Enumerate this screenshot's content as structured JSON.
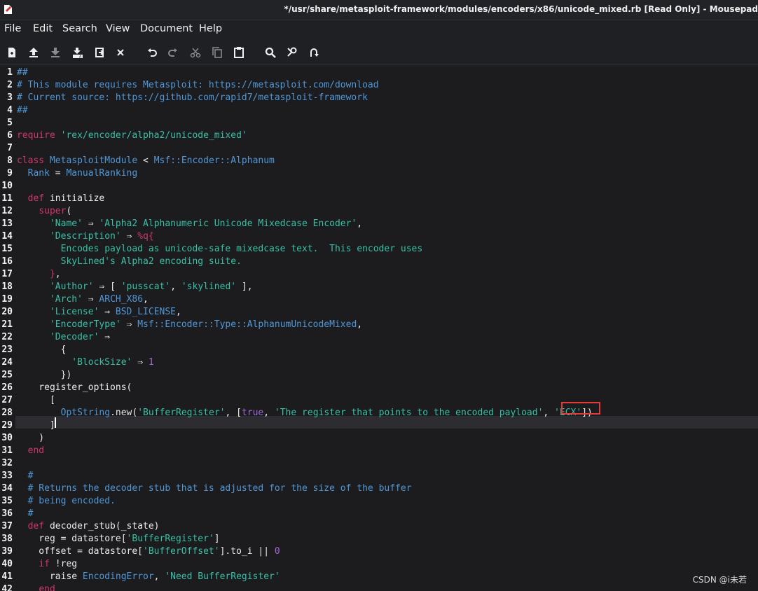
{
  "window": {
    "title": "*/usr/share/metasploit-framework/modules/encoders/x86/unicode_mixed.rb [Read Only] - Mousepad",
    "app_icon": "mousepad-icon"
  },
  "menu": [
    "File",
    "Edit",
    "Search",
    "View",
    "Document",
    "Help"
  ],
  "toolbar": [
    {
      "name": "new-document-button",
      "icon": "new-document-icon"
    },
    {
      "name": "open-file-button",
      "icon": "upload-icon"
    },
    {
      "name": "save-button",
      "icon": "download-icon"
    },
    {
      "name": "save-as-button",
      "icon": "save-as-icon"
    },
    {
      "name": "reload-button",
      "icon": "reload-icon"
    },
    {
      "name": "close-button",
      "icon": "close-icon"
    },
    {
      "name": "undo-button",
      "icon": "undo-icon"
    },
    {
      "name": "redo-button",
      "icon": "redo-icon"
    },
    {
      "name": "cut-button",
      "icon": "scissors-icon"
    },
    {
      "name": "copy-button",
      "icon": "copy-icon"
    },
    {
      "name": "paste-button",
      "icon": "paste-icon"
    },
    {
      "name": "find-button",
      "icon": "search-icon"
    },
    {
      "name": "find-replace-button",
      "icon": "find-replace-icon"
    },
    {
      "name": "goto-line-button",
      "icon": "jump-icon"
    }
  ],
  "editor": {
    "current_line": 29,
    "highlighted_token": "'ECX'",
    "lines": [
      [
        [
          "cm",
          "##"
        ]
      ],
      [
        [
          "cm",
          "# This module requires Metasploit: https://metasploit.com/download"
        ]
      ],
      [
        [
          "cm",
          "# Current source: https://github.com/rapid7/metasploit-framework"
        ]
      ],
      [
        [
          "cm",
          "##"
        ]
      ],
      [],
      [
        [
          "kw",
          "require"
        ],
        [
          "pl",
          " "
        ],
        [
          "str",
          "'rex/encoder/alpha2/unicode_mixed'"
        ]
      ],
      [],
      [
        [
          "kw",
          "class"
        ],
        [
          "pl",
          " "
        ],
        [
          "cls",
          "MetasploitModule"
        ],
        [
          "pl",
          " < "
        ],
        [
          "cls",
          "Msf::Encoder::Alphanum"
        ]
      ],
      [
        [
          "pl",
          "  "
        ],
        [
          "cls",
          "Rank"
        ],
        [
          "pl",
          " = "
        ],
        [
          "cls",
          "ManualRanking"
        ]
      ],
      [],
      [
        [
          "pl",
          "  "
        ],
        [
          "kw",
          "def"
        ],
        [
          "pl",
          " initialize"
        ]
      ],
      [
        [
          "pl",
          "    "
        ],
        [
          "kw",
          "super"
        ],
        [
          "pl",
          "("
        ]
      ],
      [
        [
          "pl",
          "      "
        ],
        [
          "str",
          "'Name'"
        ],
        [
          "pl",
          " ⇒ "
        ],
        [
          "str",
          "'Alpha2 Alphanumeric Unicode Mixedcase Encoder'"
        ],
        [
          "pl",
          ","
        ]
      ],
      [
        [
          "pl",
          "      "
        ],
        [
          "str",
          "'Description'"
        ],
        [
          "pl",
          " ⇒ "
        ],
        [
          "br",
          "%q{"
        ]
      ],
      [
        [
          "str",
          "        Encodes payload as unicode-safe mixedcase text.  This encoder uses"
        ]
      ],
      [
        [
          "str",
          "        SkyLined's Alpha2 encoding suite."
        ]
      ],
      [
        [
          "pl",
          "      "
        ],
        [
          "br",
          "}"
        ],
        [
          "pl",
          ","
        ]
      ],
      [
        [
          "pl",
          "      "
        ],
        [
          "str",
          "'Author'"
        ],
        [
          "pl",
          " ⇒ [ "
        ],
        [
          "str",
          "'pusscat'"
        ],
        [
          "pl",
          ", "
        ],
        [
          "str",
          "'skylined'"
        ],
        [
          "pl",
          " ],"
        ]
      ],
      [
        [
          "pl",
          "      "
        ],
        [
          "str",
          "'Arch'"
        ],
        [
          "pl",
          " ⇒ "
        ],
        [
          "cls",
          "ARCH_X86"
        ],
        [
          "pl",
          ","
        ]
      ],
      [
        [
          "pl",
          "      "
        ],
        [
          "str",
          "'License'"
        ],
        [
          "pl",
          " ⇒ "
        ],
        [
          "cls",
          "BSD_LICENSE"
        ],
        [
          "pl",
          ","
        ]
      ],
      [
        [
          "pl",
          "      "
        ],
        [
          "str",
          "'EncoderType'"
        ],
        [
          "pl",
          " ⇒ "
        ],
        [
          "cls",
          "Msf::Encoder::Type::AlphanumUnicodeMixed"
        ],
        [
          "pl",
          ","
        ]
      ],
      [
        [
          "pl",
          "      "
        ],
        [
          "str",
          "'Decoder'"
        ],
        [
          "pl",
          " ⇒"
        ]
      ],
      [
        [
          "pl",
          "        {"
        ]
      ],
      [
        [
          "pl",
          "          "
        ],
        [
          "str",
          "'BlockSize'"
        ],
        [
          "pl",
          " ⇒ "
        ],
        [
          "num",
          "1"
        ]
      ],
      [
        [
          "pl",
          "        })"
        ]
      ],
      [
        [
          "pl",
          "    register_options("
        ]
      ],
      [
        [
          "pl",
          "      ["
        ]
      ],
      [
        [
          "pl",
          "        "
        ],
        [
          "cls",
          "OptString"
        ],
        [
          "pl",
          ".new("
        ],
        [
          "str",
          "'BufferRegister'"
        ],
        [
          "pl",
          ", ["
        ],
        [
          "num",
          "true"
        ],
        [
          "pl",
          ", "
        ],
        [
          "str",
          "'The register that points to the encoded payload'"
        ],
        [
          "pl",
          ", "
        ],
        [
          "str",
          "'ECX'"
        ],
        [
          "pl",
          "])"
        ]
      ],
      [
        [
          "pl",
          "      ]"
        ]
      ],
      [
        [
          "pl",
          "    )"
        ]
      ],
      [
        [
          "pl",
          "  "
        ],
        [
          "kw",
          "end"
        ]
      ],
      [],
      [
        [
          "pl",
          "  "
        ],
        [
          "cm",
          "#"
        ]
      ],
      [
        [
          "pl",
          "  "
        ],
        [
          "cm",
          "# Returns the decoder stub that is adjusted for the size of the buffer"
        ]
      ],
      [
        [
          "pl",
          "  "
        ],
        [
          "cm",
          "# being encoded."
        ]
      ],
      [
        [
          "pl",
          "  "
        ],
        [
          "cm",
          "#"
        ]
      ],
      [
        [
          "pl",
          "  "
        ],
        [
          "kw",
          "def"
        ],
        [
          "pl",
          " decoder_stub(_state)"
        ]
      ],
      [
        [
          "pl",
          "    reg = datastore["
        ],
        [
          "str",
          "'BufferRegister'"
        ],
        [
          "pl",
          "]"
        ]
      ],
      [
        [
          "pl",
          "    offset = datastore["
        ],
        [
          "str",
          "'BufferOffset'"
        ],
        [
          "pl",
          "].to_i || "
        ],
        [
          "num",
          "0"
        ]
      ],
      [
        [
          "pl",
          "    "
        ],
        [
          "kw",
          "if"
        ],
        [
          "pl",
          " !reg"
        ]
      ],
      [
        [
          "pl",
          "      raise "
        ],
        [
          "cls",
          "EncodingError"
        ],
        [
          "pl",
          ", "
        ],
        [
          "str",
          "'Need BufferRegister'"
        ]
      ],
      [
        [
          "pl",
          "    "
        ],
        [
          "kw",
          "end"
        ]
      ]
    ]
  },
  "watermark": "CSDN @i未若"
}
